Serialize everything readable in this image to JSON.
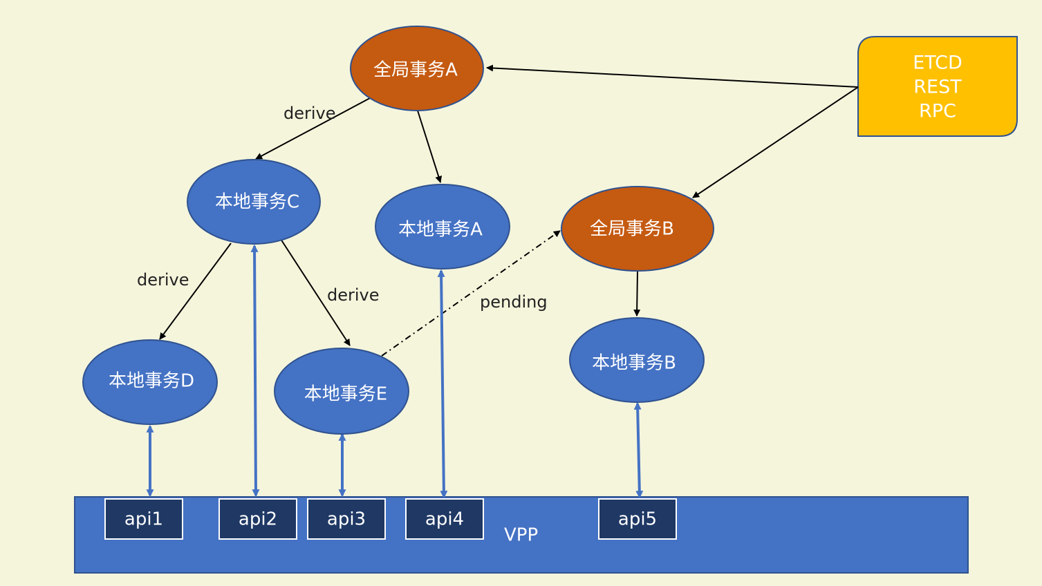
{
  "colors": {
    "background": "#f5f5dc",
    "global_node": "#c55a11",
    "local_node": "#4472c4",
    "node_stroke": "#2f528f",
    "vpp_bar": "#4472c4",
    "api_box": "#1f3864",
    "etcd_box": "#ffc000",
    "black_arrow": "#000000",
    "blue_arrow": "#4472c4"
  },
  "nodes": {
    "global_a": "全局事务A",
    "global_b": "全局事务B",
    "local_a": "本地事务A",
    "local_b": "本地事务B",
    "local_c": "本地事务C",
    "local_d": "本地事务D",
    "local_e": "本地事务E"
  },
  "etcd_box": {
    "lines": [
      "ETCD",
      "REST",
      "RPC"
    ]
  },
  "edge_labels": {
    "a_to_c": "derive",
    "c_to_d": "derive",
    "c_to_e": "derive",
    "e_to_b": "pending"
  },
  "vpp": {
    "label": "VPP",
    "apis": [
      "api1",
      "api2",
      "api3",
      "api4",
      "api5"
    ]
  }
}
